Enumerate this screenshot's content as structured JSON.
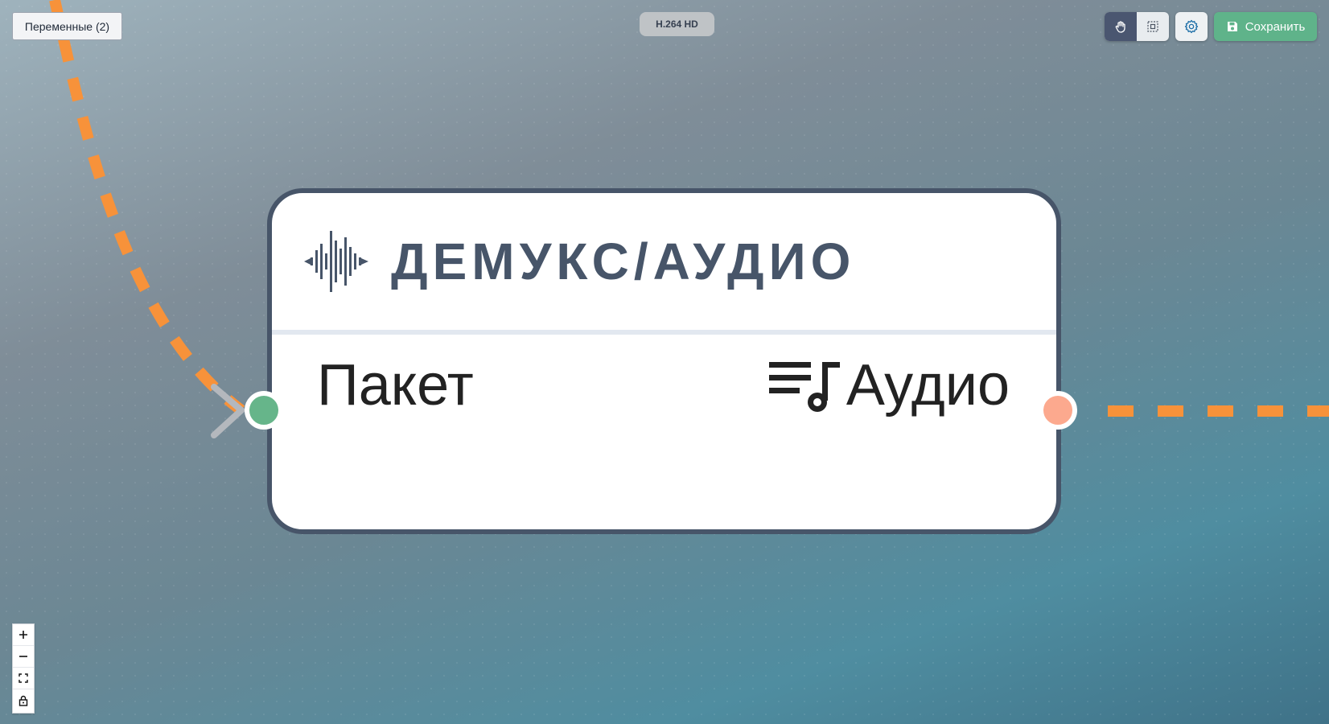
{
  "toolbar": {
    "variables_label": "Переменные (2)",
    "codec_badge": "H.264 HD",
    "save_label": "Сохранить",
    "pan_icon": "hand-icon",
    "select_icon": "select-box-icon",
    "settings_icon": "gear-icon",
    "save_icon": "floppy-disk-icon"
  },
  "node": {
    "title": "ДЕМУКС/АУДИО",
    "icon": "audio-waveform-icon",
    "input_port": {
      "label": "Пакет",
      "color": "#66b58a"
    },
    "output_port": {
      "label": "Аудио",
      "icon": "playlist-music-icon",
      "color": "#fca98e"
    }
  },
  "edges": {
    "color": "#f7923a",
    "style": "dashed"
  },
  "zoom_controls": [
    "zoom-in",
    "zoom-out",
    "fit-view",
    "lock"
  ]
}
